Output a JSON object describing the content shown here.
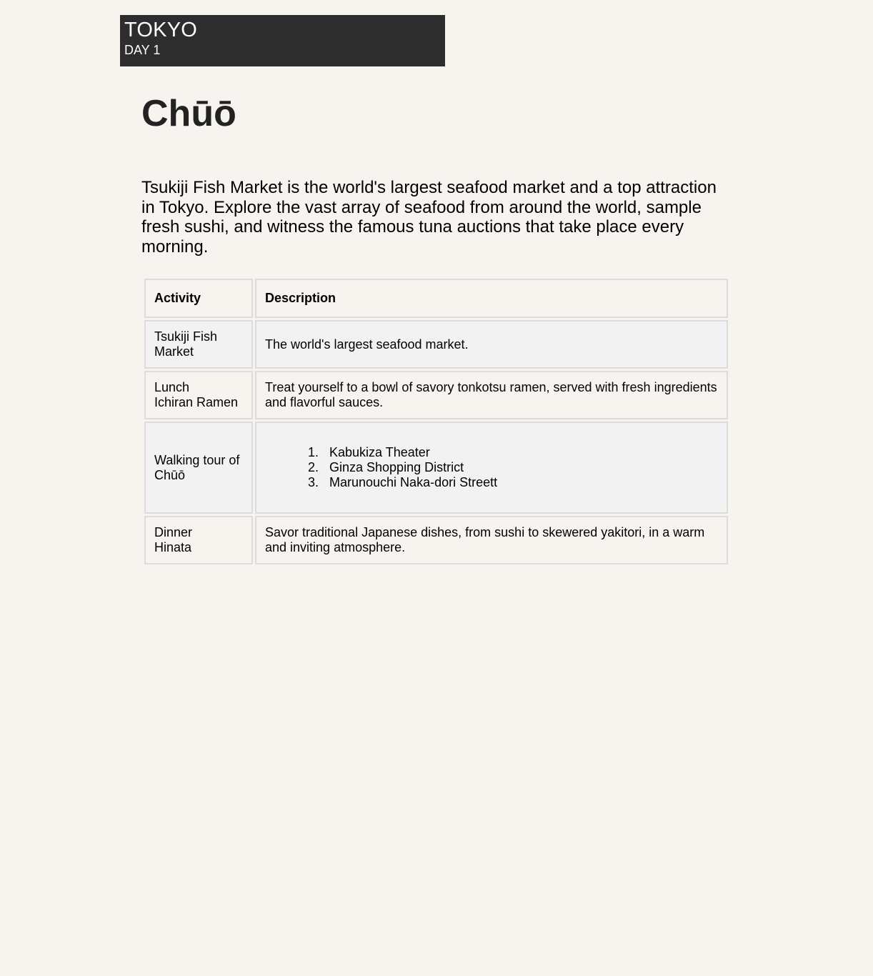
{
  "header": {
    "city": "TOKYO",
    "day": "DAY 1"
  },
  "page_title": "Chūō",
  "intro": "Tsukiji Fish Market is the world's largest seafood market and a top attraction in Tokyo. Explore the vast array of seafood from around the world, sample fresh sushi, and witness the famous tuna auctions that take place every morning.",
  "table": {
    "headers": {
      "activity": "Activity",
      "description": "Description"
    },
    "rows": [
      {
        "activity_lines": [
          "Tsukiji Fish Market"
        ],
        "description": "The world's largest seafood market."
      },
      {
        "activity_lines": [
          "Lunch",
          "Ichiran Ramen"
        ],
        "description": "Treat yourself to a bowl of savory tonkotsu ramen, served with fresh ingredients and flavorful sauces."
      },
      {
        "activity_lines": [
          "Walking tour of Chūō"
        ],
        "description_list": [
          "Kabukiza Theater",
          "Ginza Shopping District",
          "Marunouchi Naka-dori Streett"
        ]
      },
      {
        "activity_lines": [
          "Dinner",
          "Hinata"
        ],
        "description": "Savor traditional Japanese dishes, from sushi to skewered yakitori, in a warm and inviting atmosphere."
      }
    ]
  },
  "colors": {
    "page_background": "#f7f4f0",
    "header_background": "#2d2d2d",
    "shaded_row": "#f2f2f2",
    "cell_border": "#dcdcdc"
  }
}
